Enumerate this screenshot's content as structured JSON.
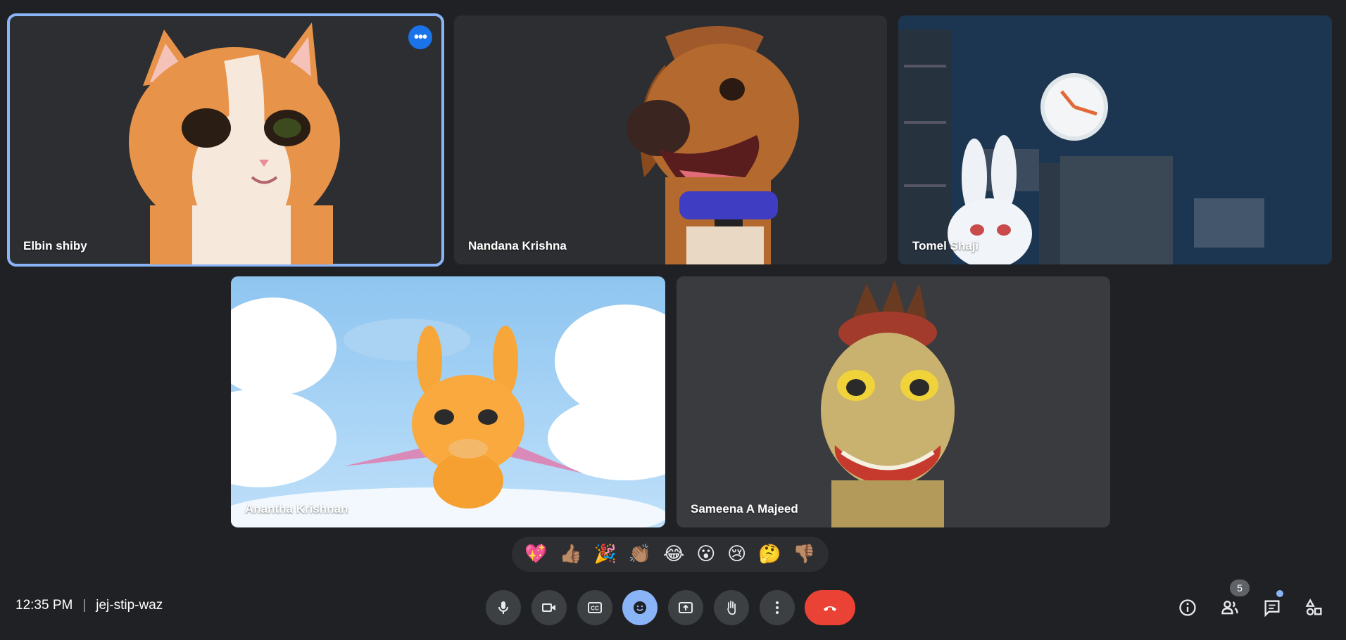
{
  "participants": [
    {
      "name": "Elbin shiby",
      "avatar": "cat-avatar",
      "active": true
    },
    {
      "name": "Nandana Krishna",
      "avatar": "dog-avatar"
    },
    {
      "name": "Tomel Shaji",
      "avatar": "bunny-avatar"
    },
    {
      "name": "Anantha Krishnan",
      "avatar": "dragon-avatar"
    },
    {
      "name": "Sameena A Majeed",
      "avatar": "dinosaur-avatar"
    }
  ],
  "tile_menu_icon": "more-horiz-icon",
  "reactions": [
    "💖",
    "👍🏽",
    "🎉",
    "👏🏽",
    "😂",
    "😮",
    "😢",
    "🤔",
    "👎🏽"
  ],
  "meeting": {
    "time": "12:35 PM",
    "separator": "|",
    "code": "jej-stip-waz"
  },
  "controls": [
    "mic-icon",
    "camera-icon",
    "captions-icon",
    "emoji-icon",
    "present-icon",
    "raise-hand-icon",
    "more-vert-icon",
    "end-call-icon"
  ],
  "right_controls": [
    "info-icon",
    "people-icon",
    "chat-icon",
    "activities-icon"
  ],
  "people_count": "5",
  "colors": {
    "background": "#202124",
    "active_outline": "#8ab4f8",
    "end_call": "#ea4335",
    "tile_menu": "#1a73e8"
  }
}
